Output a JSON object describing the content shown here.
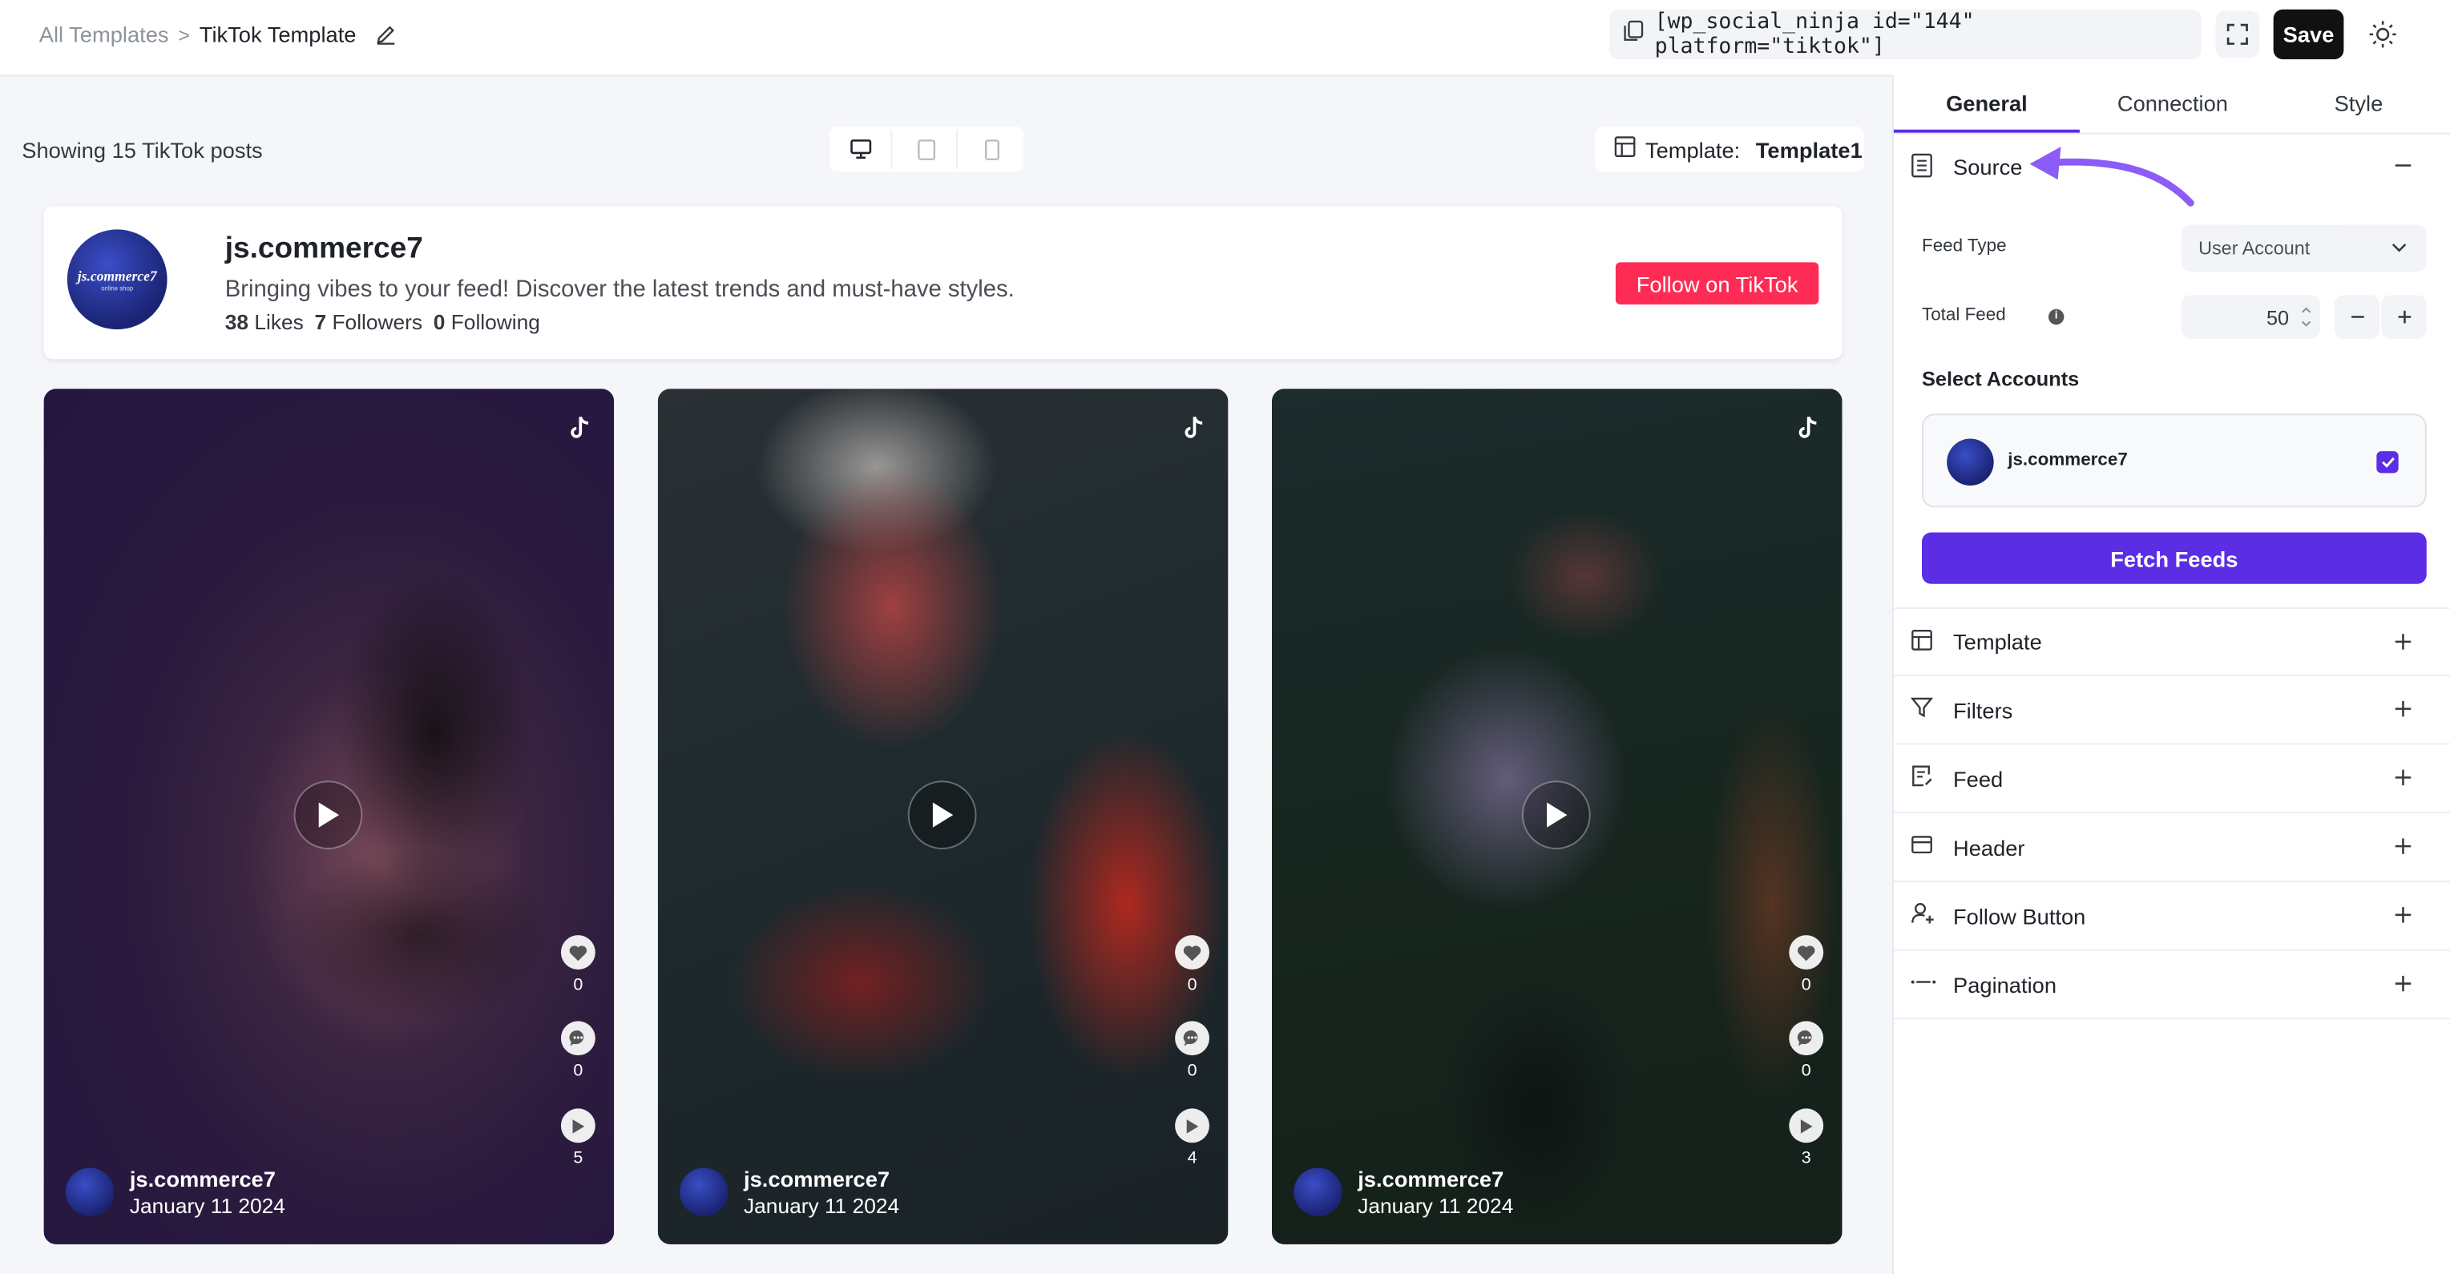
{
  "topbar": {
    "breadcrumb_parent": "All Templates",
    "breadcrumb_current": "TikTok Template",
    "shortcode": "[wp_social_ninja id=\"144\" platform=\"tiktok\"]",
    "save_label": "Save"
  },
  "preview": {
    "showing_text": "Showing 15 TikTok posts",
    "template_label": "Template:",
    "template_value": "Template1",
    "devices": [
      "desktop-icon",
      "tablet-icon",
      "mobile-icon"
    ]
  },
  "header": {
    "username": "js.commerce7",
    "avatar_text": "js.commerce7",
    "avatar_subtext": "online shop",
    "bio": "Bringing vibes to your feed! Discover the latest trends and must-have styles.",
    "likes_count": "38",
    "likes_label": "Likes",
    "followers_count": "7",
    "followers_label": "Followers",
    "following_count": "0",
    "following_label": "Following",
    "follow_button": "Follow on TikTok",
    "follow_color": "#fe2c55"
  },
  "posts": [
    {
      "username": "js.commerce7",
      "date": "January 11 2024",
      "likes": "0",
      "comments": "0",
      "views": "5"
    },
    {
      "username": "js.commerce7",
      "date": "January 11 2024",
      "likes": "0",
      "comments": "0",
      "views": "4"
    },
    {
      "username": "js.commerce7",
      "date": "January 11 2024",
      "likes": "0",
      "comments": "0",
      "views": "3"
    }
  ],
  "panel": {
    "tabs": [
      "General",
      "Connection",
      "Style"
    ],
    "active_tab": "General",
    "accent": "#5b2ee6",
    "source": {
      "title": "Source",
      "feed_type_label": "Feed Type",
      "feed_type_value": "User Account",
      "total_feed_label": "Total Feed",
      "total_feed_value": "50",
      "select_accounts_label": "Select Accounts",
      "account_name": "js.commerce7",
      "fetch_button": "Fetch Feeds"
    },
    "sections": [
      "Template",
      "Filters",
      "Feed",
      "Header",
      "Follow Button",
      "Pagination"
    ]
  }
}
